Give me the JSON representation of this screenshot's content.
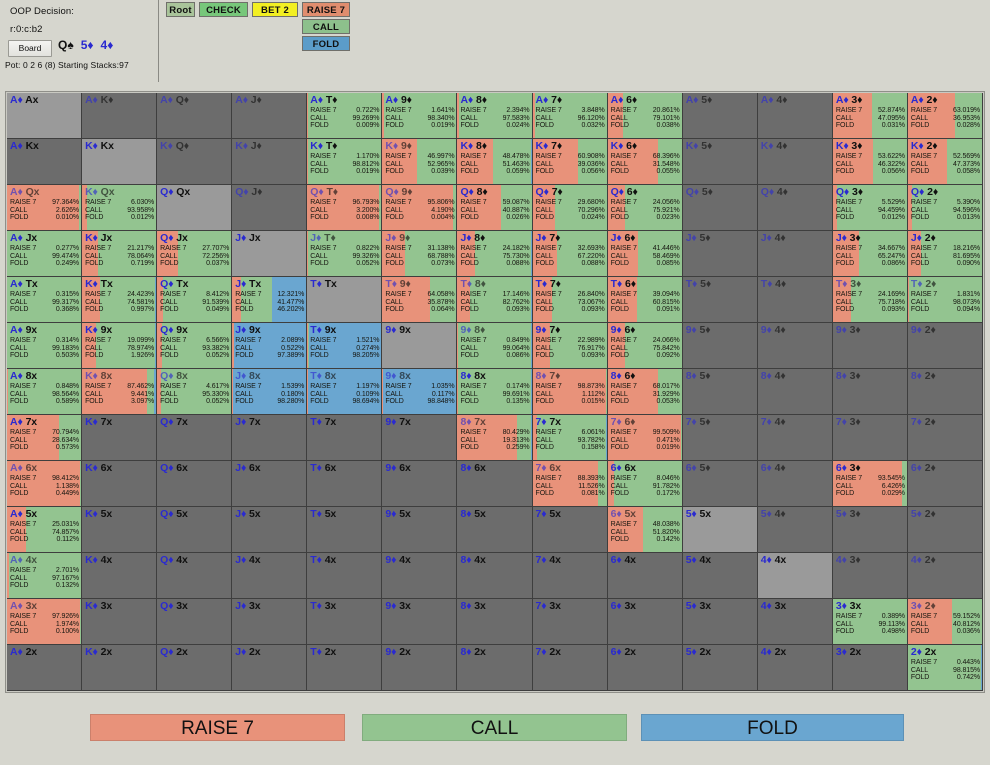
{
  "header": {
    "oop_label": "OOP Decision:",
    "node_path": "r:0:c:b2",
    "board_button": "Board",
    "board_cards": [
      {
        "rank": "Q",
        "suit": "♠",
        "suit_class": "s-spade"
      },
      {
        "rank": "5",
        "suit": "♦",
        "suit_class": "s-diamond"
      },
      {
        "rank": "4",
        "suit": "♦",
        "suit_class": "s-diamond"
      }
    ],
    "pot_line": "Pot: 0 2 6 (8) Starting Stacks:97"
  },
  "tree": {
    "root": "Root",
    "check": "CHECK",
    "bet": "BET 2",
    "raise": "RAISE 7",
    "call": "CALL",
    "fold": "FOLD"
  },
  "legend": {
    "raise": "RAISE 7",
    "call": "CALL",
    "fold": "FOLD",
    "colors": {
      "raise": "#e8927a",
      "call": "#93c490",
      "fold": "#6aa6d0"
    }
  },
  "action_labels": {
    "raise": "RAISE 7",
    "call": "CALL",
    "fold": "FOLD"
  },
  "grid": {
    "columns": [
      "A",
      "K",
      "Q",
      "J",
      "T",
      "9",
      "8",
      "7",
      "6",
      "5",
      "4",
      "3",
      "2"
    ],
    "rows": [
      "Ax",
      "Kx",
      "Qx",
      "Jx",
      "Tx",
      "9x",
      "8x",
      "7x",
      "6x",
      "5x",
      "4x",
      "3x",
      "2x"
    ],
    "cells": [
      [
        {
          "l": "A♦ Ax",
          "p": 1
        },
        {
          "l": "A♦ K♦",
          "d": 1
        },
        {
          "l": "A♦ Q♦",
          "d": 1
        },
        {
          "l": "A♦ J♦",
          "d": 1
        },
        {
          "l": "A♦ T♦",
          "s": [
            0.722,
            99.269,
            0.009
          ]
        },
        {
          "l": "A♦ 9♦",
          "s": [
            1.641,
            98.34,
            0.019
          ]
        },
        {
          "l": "A♦ 8♦",
          "s": [
            2.394,
            97.583,
            0.024
          ]
        },
        {
          "l": "A♦ 7♦",
          "s": [
            3.848,
            96.12,
            0.032
          ]
        },
        {
          "l": "A♦ 6♦",
          "s": [
            20.861,
            79.101,
            0.038
          ]
        },
        {
          "l": "A♦ 5♦",
          "d": 1
        },
        {
          "l": "A♦ 4♦",
          "d": 1
        },
        {
          "l": "A♦ 3♦",
          "s": [
            52.874,
            47.095,
            0.031
          ]
        },
        {
          "l": "A♦ 2♦",
          "s": [
            63.019,
            36.953,
            0.028
          ]
        }
      ],
      [
        {
          "l": "A♦ Kx"
        },
        {
          "l": "K♦ Kx",
          "p": 1
        },
        {
          "l": "K♦ Q♦",
          "d": 1
        },
        {
          "l": "K♦ J♦",
          "d": 1
        },
        {
          "l": "K♦ T♦",
          "s": [
            1.17,
            98.812,
            0.019
          ]
        },
        {
          "l": "K♦ 9♦",
          "s": [
            46.997,
            52.965,
            0.039
          ],
          "d": 1
        },
        {
          "l": "K♦ 8♦",
          "s": [
            48.478,
            51.463,
            0.059
          ]
        },
        {
          "l": "K♦ 7♦",
          "s": [
            60.908,
            39.036,
            0.056
          ]
        },
        {
          "l": "K♦ 6♦",
          "s": [
            68.396,
            31.548,
            0.055
          ]
        },
        {
          "l": "K♦ 5♦",
          "d": 1
        },
        {
          "l": "K♦ 4♦",
          "d": 1
        },
        {
          "l": "K♦ 3♦",
          "s": [
            53.622,
            46.322,
            0.056
          ]
        },
        {
          "l": "K♦ 2♦",
          "s": [
            52.569,
            47.373,
            0.058
          ]
        }
      ],
      [
        {
          "l": "A♦ Qx",
          "s": [
            97.364,
            2.626,
            0.01
          ],
          "d": 1
        },
        {
          "l": "K♦ Qx",
          "s": [
            6.03,
            93.958,
            0.012
          ],
          "d": 1
        },
        {
          "l": "Q♦ Qx",
          "p": 1
        },
        {
          "l": "Q♦ J♦",
          "d": 1
        },
        {
          "l": "Q♦ T♦",
          "s": [
            96.793,
            3.2,
            0.008
          ],
          "d": 1
        },
        {
          "l": "Q♦ 9♦",
          "s": [
            95.806,
            4.19,
            0.004
          ],
          "d": 1
        },
        {
          "l": "Q♦ 8♦",
          "s": [
            59.087,
            40.887,
            0.026
          ]
        },
        {
          "l": "Q♦ 7♦",
          "s": [
            29.68,
            70.296,
            0.024
          ]
        },
        {
          "l": "Q♦ 6♦",
          "s": [
            24.056,
            75.921,
            0.023
          ]
        },
        {
          "l": "Q♦ 5♦",
          "d": 1
        },
        {
          "l": "Q♦ 4♦",
          "d": 1
        },
        {
          "l": "Q♦ 3♦",
          "s": [
            5.529,
            94.459,
            0.012
          ]
        },
        {
          "l": "Q♦ 2♦",
          "s": [
            5.39,
            94.596,
            0.013
          ]
        }
      ],
      [
        {
          "l": "A♦ Jx",
          "s": [
            0.277,
            99.474,
            0.249
          ]
        },
        {
          "l": "K♦ Jx",
          "s": [
            21.217,
            78.064,
            0.719
          ]
        },
        {
          "l": "Q♦ Jx",
          "s": [
            27.707,
            72.256,
            0.037
          ]
        },
        {
          "l": "J♦ Jx",
          "p": 1
        },
        {
          "l": "J♦ T♦",
          "s": [
            0.822,
            99.326,
            0.052
          ],
          "d": 1
        },
        {
          "l": "J♦ 9♦",
          "s": [
            31.138,
            68.788,
            0.073
          ],
          "d": 1
        },
        {
          "l": "J♦ 8♦",
          "s": [
            24.182,
            75.73,
            0.088
          ]
        },
        {
          "l": "J♦ 7♦",
          "s": [
            32.693,
            67.22,
            0.088
          ]
        },
        {
          "l": "J♦ 6♦",
          "s": [
            41.446,
            58.469,
            0.085
          ]
        },
        {
          "l": "J♦ 5♦",
          "d": 1
        },
        {
          "l": "J♦ 4♦",
          "d": 1
        },
        {
          "l": "J♦ 3♦",
          "s": [
            34.667,
            65.247,
            0.086
          ]
        },
        {
          "l": "J♦ 2♦",
          "s": [
            18.216,
            81.695,
            0.09
          ]
        }
      ],
      [
        {
          "l": "A♦ Tx",
          "s": [
            0.315,
            99.317,
            0.368
          ]
        },
        {
          "l": "K♦ Tx",
          "s": [
            24.423,
            74.581,
            0.997
          ]
        },
        {
          "l": "Q♦ Tx",
          "s": [
            8.412,
            91.539,
            0.049
          ]
        },
        {
          "l": "J♦ Tx",
          "s": [
            12.321,
            41.477,
            46.202
          ]
        },
        {
          "l": "T♦ Tx",
          "p": 1
        },
        {
          "l": "T♦ 9♦",
          "s": [
            64.058,
            35.878,
            0.064
          ],
          "d": 1
        },
        {
          "l": "T♦ 8♦",
          "s": [
            17.146,
            82.762,
            0.093
          ],
          "d": 1
        },
        {
          "l": "T♦ 7♦",
          "s": [
            26.84,
            73.067,
            0.093
          ]
        },
        {
          "l": "T♦ 6♦",
          "s": [
            39.094,
            60.815,
            0.091
          ]
        },
        {
          "l": "T♦ 5♦",
          "d": 1
        },
        {
          "l": "T♦ 4♦",
          "d": 1
        },
        {
          "l": "T♦ 3♦",
          "s": [
            24.169,
            75.718,
            0.093
          ],
          "d": 1
        },
        {
          "l": "T♦ 2♦",
          "s": [
            1.831,
            98.073,
            0.094
          ],
          "d": 1
        }
      ],
      [
        {
          "l": "A♦ 9x",
          "s": [
            0.314,
            99.183,
            0.503
          ]
        },
        {
          "l": "K♦ 9x",
          "s": [
            19.099,
            78.974,
            1.926
          ]
        },
        {
          "l": "Q♦ 9x",
          "s": [
            6.566,
            93.382,
            0.052
          ]
        },
        {
          "l": "J♦ 9x",
          "s": [
            2.089,
            0.522,
            97.389
          ]
        },
        {
          "l": "T♦ 9x",
          "s": [
            1.521,
            0.274,
            98.205
          ]
        },
        {
          "l": "9♦ 9x",
          "p": 1
        },
        {
          "l": "9♦ 8♦",
          "s": [
            0.849,
            99.064,
            0.086
          ],
          "d": 1
        },
        {
          "l": "9♦ 7♦",
          "s": [
            22.989,
            76.917,
            0.093
          ]
        },
        {
          "l": "9♦ 6♦",
          "s": [
            24.066,
            75.842,
            0.092
          ]
        },
        {
          "l": "9♦ 5♦",
          "d": 1
        },
        {
          "l": "9♦ 4♦",
          "d": 1
        },
        {
          "l": "9♦ 3♦",
          "d": 1
        },
        {
          "l": "9♦ 2♦",
          "d": 1
        }
      ],
      [
        {
          "l": "A♦ 8x",
          "s": [
            0.848,
            98.564,
            0.589
          ]
        },
        {
          "l": "K♦ 8x",
          "s": [
            87.462,
            9.441,
            3.097
          ],
          "d": 1
        },
        {
          "l": "Q♦ 8x",
          "s": [
            4.617,
            95.33,
            0.052
          ],
          "d": 1
        },
        {
          "l": "J♦ 8x",
          "s": [
            1.539,
            0.18,
            98.28
          ],
          "d": 1
        },
        {
          "l": "T♦ 8x",
          "s": [
            1.197,
            0.109,
            98.694
          ],
          "d": 1
        },
        {
          "l": "9♦ 8x",
          "s": [
            1.035,
            0.117,
            98.848
          ],
          "d": 1
        },
        {
          "l": "8♦ 8x",
          "p": 1,
          "s": [
            0.174,
            99.691,
            0.135
          ]
        },
        {
          "l": "8♦ 7♦",
          "s": [
            98.873,
            1.112,
            0.015
          ],
          "d": 1
        },
        {
          "l": "8♦ 6♦",
          "s": [
            68.017,
            31.929,
            0.053
          ]
        },
        {
          "l": "8♦ 5♦",
          "d": 1
        },
        {
          "l": "8♦ 4♦",
          "d": 1
        },
        {
          "l": "8♦ 3♦",
          "d": 1
        },
        {
          "l": "8♦ 2♦",
          "d": 1
        }
      ],
      [
        {
          "l": "A♦ 7x",
          "s": [
            70.794,
            28.634,
            0.573
          ]
        },
        {
          "l": "K♦ 7x"
        },
        {
          "l": "Q♦ 7x"
        },
        {
          "l": "J♦ 7x"
        },
        {
          "l": "T♦ 7x"
        },
        {
          "l": "9♦ 7x"
        },
        {
          "l": "8♦ 7x",
          "s": [
            80.429,
            19.313,
            0.259
          ],
          "d": 1
        },
        {
          "l": "7♦ 7x",
          "p": 1,
          "s": [
            6.061,
            93.782,
            0.158
          ]
        },
        {
          "l": "7♦ 6♦",
          "s": [
            99.509,
            0.471,
            0.019
          ],
          "d": 1
        },
        {
          "l": "7♦ 5♦",
          "d": 1
        },
        {
          "l": "7♦ 4♦",
          "d": 1
        },
        {
          "l": "7♦ 3♦",
          "d": 1
        },
        {
          "l": "7♦ 2♦",
          "d": 1
        }
      ],
      [
        {
          "l": "A♦ 6x",
          "s": [
            98.412,
            1.138,
            0.449
          ],
          "d": 1
        },
        {
          "l": "K♦ 6x"
        },
        {
          "l": "Q♦ 6x"
        },
        {
          "l": "J♦ 6x"
        },
        {
          "l": "T♦ 6x"
        },
        {
          "l": "9♦ 6x"
        },
        {
          "l": "8♦ 6x"
        },
        {
          "l": "7♦ 6x",
          "s": [
            88.393,
            11.526,
            0.081
          ],
          "d": 1
        },
        {
          "l": "6♦ 6x",
          "p": 1,
          "s": [
            8.046,
            91.782,
            0.172
          ]
        },
        {
          "l": "6♦ 5♦",
          "d": 1
        },
        {
          "l": "6♦ 4♦",
          "d": 1
        },
        {
          "l": "6♦ 3♦",
          "s": [
            93.545,
            6.426,
            0.029
          ]
        },
        {
          "l": "6♦ 2♦",
          "d": 1
        }
      ],
      [
        {
          "l": "A♦ 5x",
          "s": [
            25.031,
            74.857,
            0.112
          ]
        },
        {
          "l": "K♦ 5x"
        },
        {
          "l": "Q♦ 5x"
        },
        {
          "l": "J♦ 5x"
        },
        {
          "l": "T♦ 5x"
        },
        {
          "l": "9♦ 5x"
        },
        {
          "l": "8♦ 5x"
        },
        {
          "l": "7♦ 5x"
        },
        {
          "l": "6♦ 5x",
          "s": [
            48.038,
            51.82,
            0.142
          ],
          "d": 1
        },
        {
          "l": "5♦ 5x",
          "p": 1
        },
        {
          "l": "5♦ 4♦",
          "d": 1
        },
        {
          "l": "5♦ 3♦",
          "d": 1
        },
        {
          "l": "5♦ 2♦",
          "d": 1
        }
      ],
      [
        {
          "l": "A♦ 4x",
          "s": [
            2.701,
            97.167,
            0.132
          ],
          "d": 1
        },
        {
          "l": "K♦ 4x"
        },
        {
          "l": "Q♦ 4x"
        },
        {
          "l": "J♦ 4x"
        },
        {
          "l": "T♦ 4x"
        },
        {
          "l": "9♦ 4x"
        },
        {
          "l": "8♦ 4x"
        },
        {
          "l": "7♦ 4x"
        },
        {
          "l": "6♦ 4x"
        },
        {
          "l": "5♦ 4x"
        },
        {
          "l": "4♦ 4x",
          "p": 1
        },
        {
          "l": "4♦ 3♦",
          "d": 1
        },
        {
          "l": "4♦ 2♦",
          "d": 1
        }
      ],
      [
        {
          "l": "A♦ 3x",
          "s": [
            97.926,
            1.974,
            0.1
          ],
          "d": 1
        },
        {
          "l": "K♦ 3x"
        },
        {
          "l": "Q♦ 3x"
        },
        {
          "l": "J♦ 3x"
        },
        {
          "l": "T♦ 3x"
        },
        {
          "l": "9♦ 3x"
        },
        {
          "l": "8♦ 3x"
        },
        {
          "l": "7♦ 3x"
        },
        {
          "l": "6♦ 3x"
        },
        {
          "l": "5♦ 3x"
        },
        {
          "l": "4♦ 3x"
        },
        {
          "l": "3♦ 3x",
          "p": 1,
          "s": [
            0.389,
            99.113,
            0.498
          ]
        },
        {
          "l": "3♦ 2♦",
          "s": [
            59.152,
            40.812,
            0.036
          ],
          "d": 1
        }
      ],
      [
        {
          "l": "A♦ 2x"
        },
        {
          "l": "K♦ 2x"
        },
        {
          "l": "Q♦ 2x"
        },
        {
          "l": "J♦ 2x"
        },
        {
          "l": "T♦ 2x"
        },
        {
          "l": "9♦ 2x"
        },
        {
          "l": "8♦ 2x"
        },
        {
          "l": "7♦ 2x"
        },
        {
          "l": "6♦ 2x"
        },
        {
          "l": "5♦ 2x"
        },
        {
          "l": "4♦ 2x"
        },
        {
          "l": "3♦ 2x"
        },
        {
          "l": "2♦ 2x",
          "p": 1,
          "s": [
            0.443,
            98.815,
            0.742
          ]
        }
      ]
    ]
  }
}
